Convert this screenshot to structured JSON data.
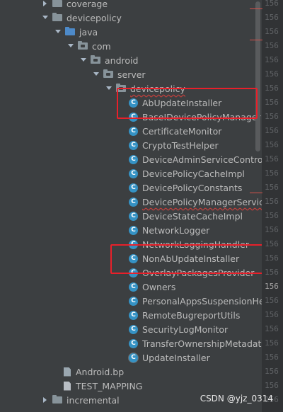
{
  "tree": {
    "rows": [
      {
        "label": "coverage",
        "indent": 0,
        "arrow": "closed",
        "icon": "folder",
        "underline": false
      },
      {
        "label": "devicepolicy",
        "indent": 0,
        "arrow": "open",
        "icon": "folder",
        "underline": false
      },
      {
        "label": "java",
        "indent": 1,
        "arrow": "open",
        "icon": "folder-blue",
        "underline": false
      },
      {
        "label": "com",
        "indent": 2,
        "arrow": "open",
        "icon": "package",
        "underline": false
      },
      {
        "label": "android",
        "indent": 3,
        "arrow": "open",
        "icon": "package",
        "underline": false
      },
      {
        "label": "server",
        "indent": 4,
        "arrow": "open",
        "icon": "package",
        "underline": false
      },
      {
        "label": "devicepolicy",
        "indent": 5,
        "arrow": "open",
        "icon": "package",
        "underline": true
      },
      {
        "label": "AbUpdateInstaller",
        "indent": 6,
        "arrow": "none",
        "icon": "class",
        "underline": false
      },
      {
        "label": "BaseIDevicePolicyManager",
        "indent": 6,
        "arrow": "none",
        "icon": "class",
        "underline": false
      },
      {
        "label": "CertificateMonitor",
        "indent": 6,
        "arrow": "none",
        "icon": "class",
        "underline": false
      },
      {
        "label": "CryptoTestHelper",
        "indent": 6,
        "arrow": "none",
        "icon": "class",
        "underline": false
      },
      {
        "label": "DeviceAdminServiceController",
        "indent": 6,
        "arrow": "none",
        "icon": "class",
        "underline": false
      },
      {
        "label": "DevicePolicyCacheImpl",
        "indent": 6,
        "arrow": "none",
        "icon": "class",
        "underline": false
      },
      {
        "label": "DevicePolicyConstants",
        "indent": 6,
        "arrow": "none",
        "icon": "class",
        "underline": false
      },
      {
        "label": "DevicePolicyManagerService",
        "indent": 6,
        "arrow": "none",
        "icon": "class",
        "underline": true
      },
      {
        "label": "DeviceStateCacheImpl",
        "indent": 6,
        "arrow": "none",
        "icon": "class",
        "underline": false
      },
      {
        "label": "NetworkLogger",
        "indent": 6,
        "arrow": "none",
        "icon": "class",
        "underline": false
      },
      {
        "label": "NetworkLoggingHandler",
        "indent": 6,
        "arrow": "none",
        "icon": "class",
        "underline": false
      },
      {
        "label": "NonAbUpdateInstaller",
        "indent": 6,
        "arrow": "none",
        "icon": "class",
        "underline": false
      },
      {
        "label": "OverlayPackagesProvider",
        "indent": 6,
        "arrow": "none",
        "icon": "class",
        "underline": false
      },
      {
        "label": "Owners",
        "indent": 6,
        "arrow": "none",
        "icon": "class",
        "underline": false
      },
      {
        "label": "PersonalAppsSuspensionHelper",
        "indent": 6,
        "arrow": "none",
        "icon": "class",
        "underline": false
      },
      {
        "label": "RemoteBugreportUtils",
        "indent": 6,
        "arrow": "none",
        "icon": "class",
        "underline": false
      },
      {
        "label": "SecurityLogMonitor",
        "indent": 6,
        "arrow": "none",
        "icon": "class",
        "underline": false
      },
      {
        "label": "TransferOwnershipMetadataManager",
        "indent": 6,
        "arrow": "none",
        "icon": "class",
        "underline": false
      },
      {
        "label": "UpdateInstaller",
        "indent": 6,
        "arrow": "none",
        "icon": "class-abstract",
        "underline": false
      },
      {
        "label": "Android.bp",
        "indent": 2,
        "arrow": "none",
        "icon": "file",
        "underline": false
      },
      {
        "label": "TEST_MAPPING",
        "indent": 2,
        "arrow": "none",
        "icon": "file-plain",
        "underline": false
      },
      {
        "label": "incremental",
        "indent": 0,
        "arrow": "closed",
        "icon": "folder",
        "underline": false
      }
    ]
  },
  "gutter": {
    "lines": [
      "156",
      "156",
      "156",
      "156",
      "156",
      "156",
      "156",
      "156",
      "156",
      "156",
      "156",
      "156",
      "156",
      "156",
      "156",
      "156",
      "156",
      "156",
      "156",
      "156",
      "156",
      "156",
      "156",
      "156",
      "156",
      "156",
      "156",
      "156",
      "156"
    ],
    "current_index": 20
  },
  "watermark": "CSDN @yjz_0314",
  "colors": {
    "highlight_box": "#e8202a",
    "class_icon": "#3592c4",
    "error_underline": "#bc3f3c"
  }
}
